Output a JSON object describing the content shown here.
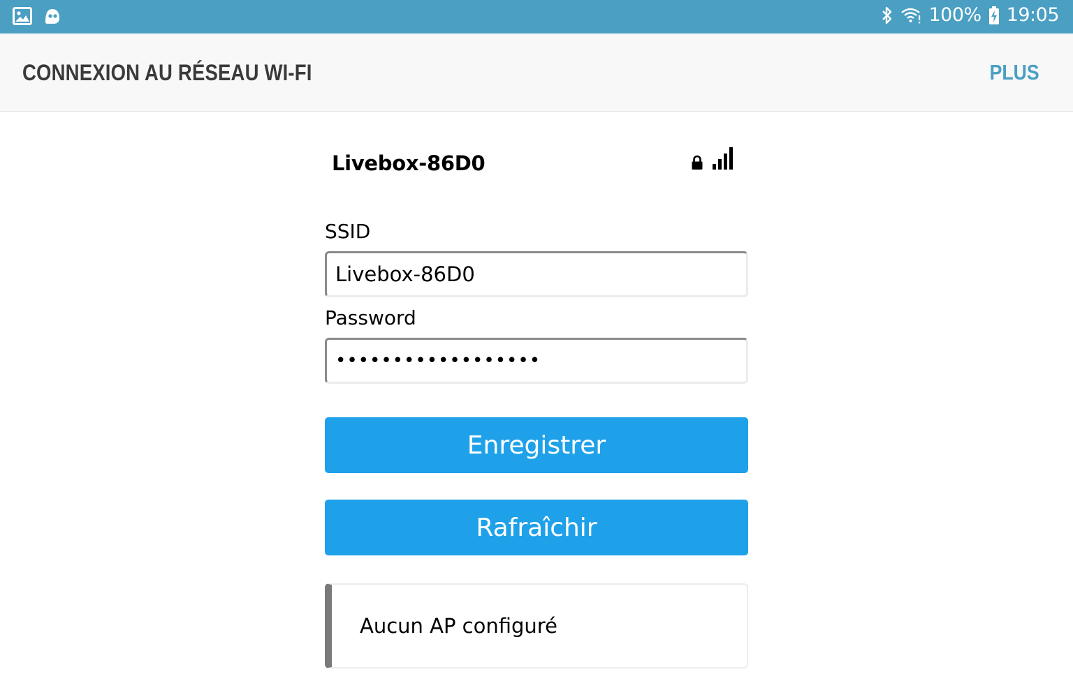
{
  "status_bar": {
    "left_icons": [
      "gallery-icon",
      "ghost-app-icon"
    ],
    "right_icons": [
      "bluetooth-icon",
      "wifi-icon",
      "battery-charging-icon"
    ],
    "battery": "100%",
    "time": "19:05"
  },
  "app_bar": {
    "title": "CONNEXION AU RÉSEAU WI-FI",
    "more_label": "PLUS"
  },
  "network": {
    "name": "Livebox-86D0",
    "icons": [
      "lock-icon",
      "signal-strength-icon"
    ]
  },
  "form": {
    "ssid_label": "SSID",
    "ssid_value": "Livebox-86D0",
    "password_label": "Password",
    "password_value": "••••••••••••••••••"
  },
  "buttons": {
    "save_label": "Enregistrer",
    "refresh_label": "Rafraîchir"
  },
  "notice": {
    "text": "Aucun AP configuré"
  },
  "colors": {
    "status_bar": "#4a9fc3",
    "accent": "#4a9fc3",
    "button": "#1fa1ea",
    "app_bar": "#f8f8f8",
    "notice_border": "#7a7a7a"
  }
}
